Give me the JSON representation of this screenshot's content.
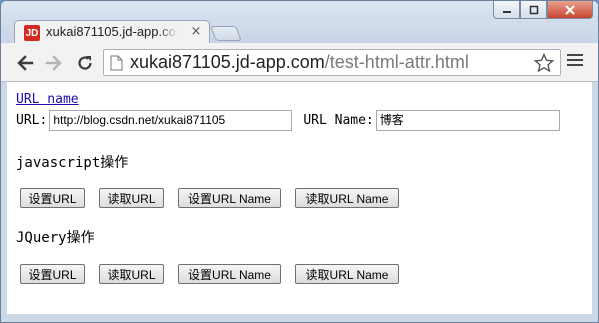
{
  "window": {
    "controls": {
      "minimize": "▭",
      "maximize": "□",
      "close": "✕"
    }
  },
  "tab": {
    "favicon_text": "JD",
    "title": "xukai871105.jd-app.com/test-html-attr.html",
    "close_glyph": "×"
  },
  "toolbar": {
    "back_icon": "arrow-left-icon",
    "forward_icon": "arrow-right-icon",
    "reload_icon": "reload-icon",
    "url_host": "xukai871105.jd-app.com",
    "url_path": "/test-html-attr.html",
    "bookmark_icon": "star-icon",
    "menu_icon": "hamburger-menu-icon"
  },
  "page": {
    "link_text": "URL name",
    "url_label": "URL:",
    "url_value": "http://blog.csdn.net/xukai871105",
    "url_name_label": "URL Name:",
    "url_name_value": "博客",
    "js_section": "javascript操作",
    "js_buttons": [
      "设置URL",
      "读取URL",
      "设置URL Name",
      "读取URL Name"
    ],
    "jquery_section": "JQuery操作",
    "jquery_buttons": [
      "设置URL",
      "读取URL",
      "设置URL Name",
      "读取URL Name"
    ]
  },
  "colors": {
    "link": "#1a0dab",
    "close_button": "#c7452f",
    "favicon": "#d12b24"
  }
}
